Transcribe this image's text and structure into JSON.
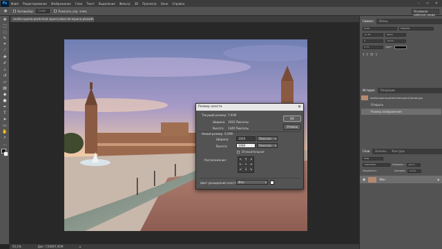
{
  "app": {
    "logo": "Ps",
    "menu": [
      "Файл",
      "Редактирование",
      "Изображение",
      "Слои",
      "Текст",
      "Выделение",
      "Фильтр",
      "3D",
      "Просмотр",
      "Окно",
      "Справка"
    ],
    "window_controls": [
      "–",
      "▭",
      "✕"
    ]
  },
  "options_bar": {
    "auto_select_label": "Автовыбор:",
    "auto_select_value": "Слой",
    "show_transform_label": "Показать упр. элем.",
    "workspace": "Основная рабочая среда"
  },
  "tools": [
    "move",
    "marquee",
    "lasso",
    "quick-select",
    "crop",
    "eyedropper",
    "healing",
    "brush",
    "clone-stamp",
    "history-brush",
    "eraser",
    "gradient",
    "blur",
    "dodge",
    "pen",
    "type",
    "path-select",
    "shape",
    "hand",
    "zoom",
    "more",
    "colors"
  ],
  "document": {
    "tab_title": "sevilla-ispania-ploshchad-ispanii-plaza-de-espana-plaza-fontan.jpg @ 55,1% (RGB/8#) *",
    "tab_close": "×"
  },
  "status_bar": {
    "zoom": "55,1%",
    "doc_info": "Док: 7,91M/7,91M",
    "arrow": "▸"
  },
  "right_panel": {
    "color_tabs": [
      "Символ",
      "Абзац"
    ],
    "char_fields": [
      "Arial",
      "Regular",
      "12 пт",
      "Авто",
      "0",
      "100%",
      "0 пт",
      "Цвет:"
    ],
    "history_tabs": [
      "История",
      "Операции"
    ],
    "history_file": "sevilla-ispania-ploshchad-ispanii-fontan.jpg",
    "history_items": [
      "Открыть",
      "Размер изображения"
    ],
    "layers_tabs": [
      "Слои",
      "Каналы",
      "Контуры"
    ],
    "layers_controls": [
      "Вид",
      "Обычные",
      "Непрозр.:",
      "100%",
      "Закрепить:",
      "Заливка:",
      "100%"
    ],
    "layer_name": "Фон"
  },
  "dialog": {
    "title": "Размер холста",
    "close": "✕",
    "current_size_label": "Текущий размер: 7,91M",
    "current_width_label": "Ширина:",
    "current_width_value": "1920 Пикселы",
    "current_height_label": "Высота:",
    "current_height_value": "1440 Пикселы",
    "new_size_label": "Новый размер: 5,93M",
    "width_label": "Ширина:",
    "width_value": "1920",
    "width_unit": "Пиксели",
    "height_label": "Высота:",
    "height_value": "1080",
    "height_unit": "Пиксели",
    "relative_label": "Относительная",
    "anchor_label": "Расположение:",
    "anchor_arrows": [
      "↖",
      "↑",
      "↗",
      "←",
      "•",
      "→",
      "↙",
      "↓",
      "↘"
    ],
    "ok_label": "OK",
    "cancel_label": "Отмена",
    "extension_color_label": "Цвет расширения холста:",
    "extension_color_value": "Фон",
    "extension_swatch": "#ffffff"
  }
}
